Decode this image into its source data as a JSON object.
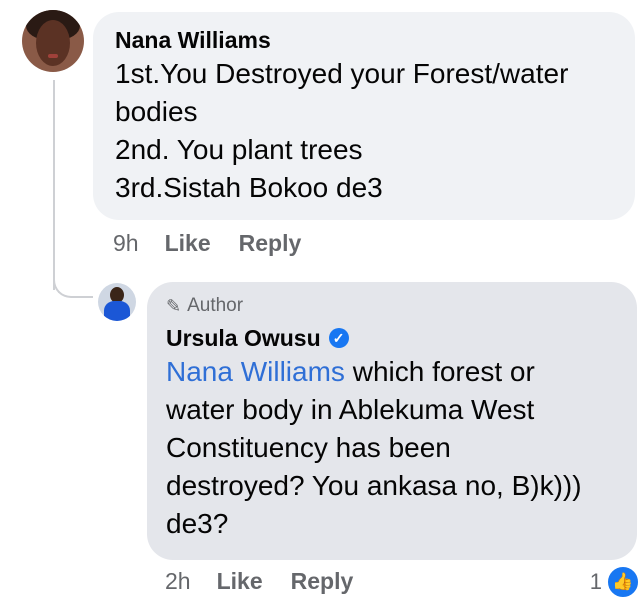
{
  "comment": {
    "author": "Nana Williams",
    "lines": [
      "1st.You Destroyed your Forest/water",
      "bodies",
      "2nd. You plant trees",
      "3rd.Sistah Bokoo de3"
    ],
    "time": "9h",
    "like_label": "Like",
    "reply_label": "Reply"
  },
  "reply": {
    "author_tag": "Author",
    "author": "Ursula Owusu",
    "verified": true,
    "mention": "Nana Williams",
    "text_first_line_rest": " which forest or",
    "lines": [
      "water body in Ablekuma West",
      "Constituency has been",
      "destroyed? You ankasa no, B)k)))",
      "de3?"
    ],
    "time": "2h",
    "like_label": "Like",
    "reply_label": "Reply",
    "reaction_count": "1",
    "reaction_icon": "thumbs-up-icon"
  },
  "colors": {
    "accent": "#1877f2",
    "mention": "#2f6fd6",
    "bubble": "#f0f2f5",
    "bubble_reply": "#e4e6eb",
    "meta": "#65676b"
  }
}
